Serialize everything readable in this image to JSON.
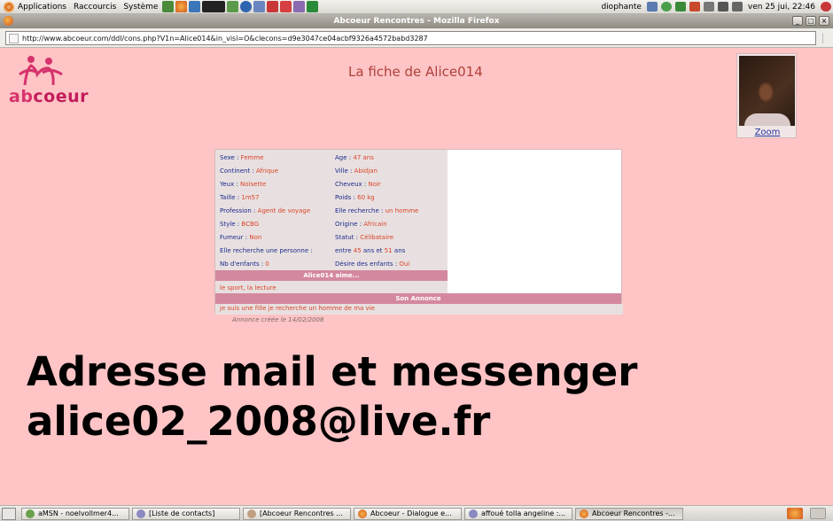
{
  "top_panel": {
    "menus": [
      "Applications",
      "Raccourcis",
      "Système"
    ],
    "user": "diophante",
    "clock": "ven 25 jui, 22:46"
  },
  "window": {
    "title": "Abcoeur Rencontres - Mozilla Firefox",
    "url": "http://www.abcoeur.com/ddl/cons.php?V1n=Alice014&in_visi=O&clecons=d9e3047ce04acbf9326a4572babd3287"
  },
  "page": {
    "logo": {
      "part1": "ab",
      "part2": "coeur"
    },
    "title": "La fiche de Alice014",
    "zoom_label": "Zoom",
    "profile": {
      "left": [
        {
          "label": "Sexe : ",
          "value": "Femme"
        },
        {
          "label": "Continent : ",
          "value": "Afrique"
        },
        {
          "label": "Yeux : ",
          "value": "Noisette"
        },
        {
          "label": "Taille : ",
          "value": "1m57"
        },
        {
          "label": "Profession : ",
          "value": "Agent de voyage"
        },
        {
          "label": "Style : ",
          "value": "BCBG"
        },
        {
          "label": "Fumeur : ",
          "value": "Non"
        },
        {
          "label": "Elle recherche une personne :",
          "value": ""
        },
        {
          "label": "Nb d'enfants : ",
          "value": "0"
        }
      ],
      "right": [
        {
          "label": "Age : ",
          "value": "47 ans"
        },
        {
          "label": "Ville : ",
          "value": "Abidjan"
        },
        {
          "label": "Cheveux : ",
          "value": "Noir"
        },
        {
          "label": "Poids : ",
          "value": "60 kg"
        },
        {
          "label": "Elle recherche : ",
          "value": "un homme"
        },
        {
          "label": "Origine : ",
          "value": "Africain"
        },
        {
          "label": "Statut : ",
          "value": "Célibataire"
        }
      ],
      "age_range": {
        "p1": "entre ",
        "min": "45",
        "p2": " ans et ",
        "max": "51",
        "p3": " ans"
      },
      "children_wish": {
        "label": "Désire des enfants : ",
        "value": "Oui"
      },
      "likes_title": "Alice014 aime...",
      "likes": "le sport, la lecture",
      "ad_title": "Son Annonce",
      "ad_text": "je suis une fille je recherche un homme de ma vie",
      "created": "Annonce créée le 14/02/2008"
    },
    "overlay_lines": [
      "Adresse mail et messenger",
      "alice02_2008@live.fr"
    ]
  },
  "taskbar": {
    "tasks": [
      "aMSN - noelvollmer4...",
      "[Liste de contacts]",
      "[Abcoeur Rencontres ...",
      "Abcoeur - Dialogue e...",
      "affoué tolla angeline :...",
      "Abcoeur Rencontres -..."
    ]
  },
  "colors": {
    "page_bg": "#ffc4c5",
    "label_blue": "#1a2a8c",
    "value_red": "#d9442a",
    "section_pink": "#d4889e"
  }
}
